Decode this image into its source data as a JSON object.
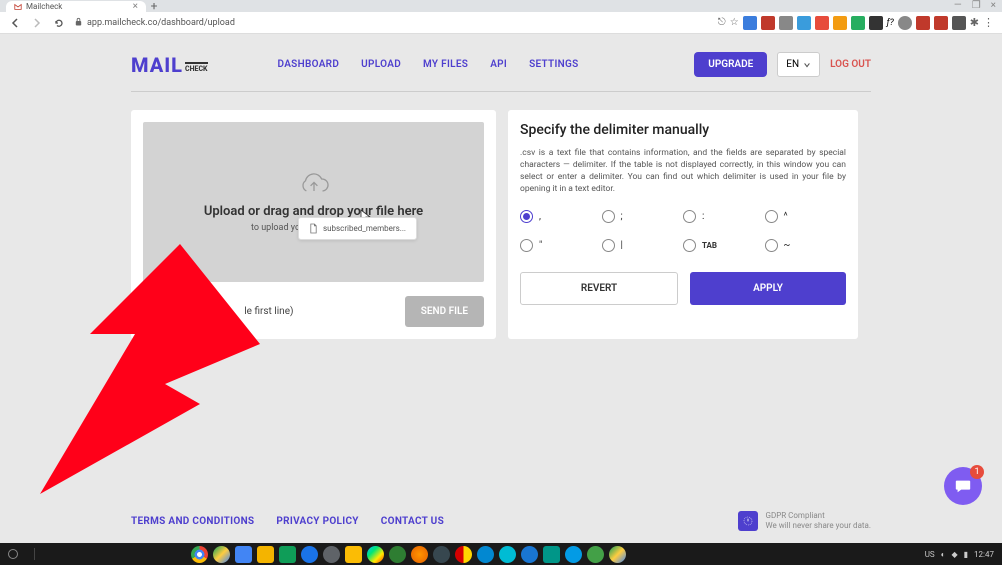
{
  "browser": {
    "tab_title": "Mailcheck",
    "url": "app.mailcheck.co/dashboard/upload"
  },
  "header": {
    "logo_main": "MAIL",
    "logo_sub": "CHECK",
    "nav": {
      "dashboard": "DASHBOARD",
      "upload": "UPLOAD",
      "myfiles": "MY FILES",
      "api": "API",
      "settings": "SETTINGS"
    },
    "upgrade": "UPGRADE",
    "lang": "EN",
    "logout": "LOG OUT"
  },
  "upload_panel": {
    "title": "Upload or drag and drop your file here",
    "subtitle": "to upload your file (max 20 MB)",
    "file_label": "subscribed_members...",
    "first_line": "le first line)",
    "send_file": "SEND FILE"
  },
  "delimiter_panel": {
    "title": "Specify the delimiter manually",
    "description": ".csv is a text file that contains information, and the fields are separated by special characters — delimiter. If the table is not displayed correctly, in this window you can select or enter a delimiter. You can find out which delimiter is used in your file by opening it in a text editor.",
    "options": {
      "comma": ",",
      "semicolon": ";",
      "colon": ":",
      "caret": "^",
      "quote": "\"",
      "pipe": "|",
      "tab": "TAB",
      "tilde": "~"
    },
    "revert": "REVERT",
    "apply": "APPLY"
  },
  "footer": {
    "terms": "TERMS AND CONDITIONS",
    "privacy": "PRIVACY POLICY",
    "contact": "CONTACT US",
    "gdpr_title": "GDPR Compliant",
    "gdpr_sub": "We will never share your data."
  },
  "chat": {
    "badge": "1"
  },
  "tray": {
    "status": "US",
    "time": "12:47"
  }
}
